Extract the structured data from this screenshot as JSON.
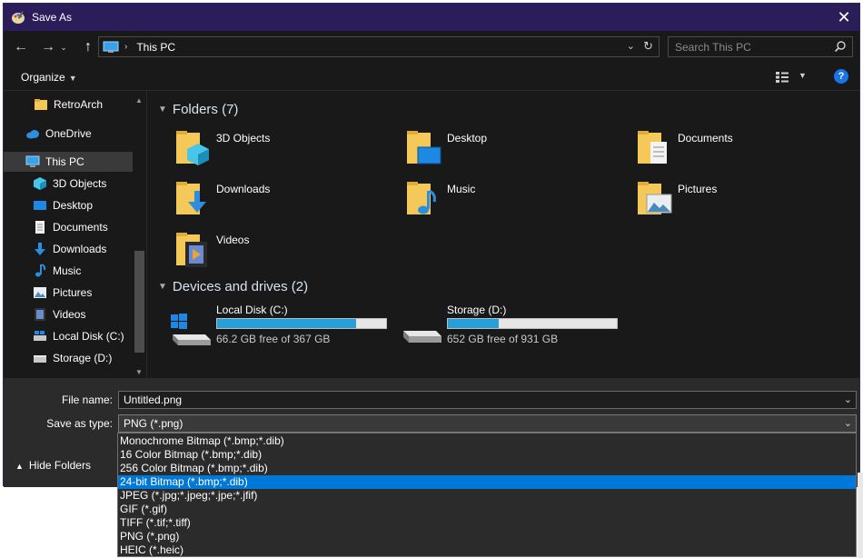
{
  "window": {
    "title": "Save As",
    "close_label": "✕",
    "app_icon": "paint-palette-icon"
  },
  "nav": {
    "back": "←",
    "forward": "→",
    "recent": "⌄",
    "up": "↑",
    "address_path": "This PC",
    "address_sep": "›",
    "search_placeholder": "Search This PC"
  },
  "toolbar": {
    "organize_label": "Organize",
    "help_label": "?"
  },
  "sidebar": {
    "items": [
      {
        "label": "RetroArch",
        "icon": "folder-icon"
      },
      {
        "label": "OneDrive",
        "icon": "cloud-icon"
      },
      {
        "label": "This PC",
        "icon": "computer-icon",
        "selected": true
      },
      {
        "label": "3D Objects",
        "icon": "cube-icon"
      },
      {
        "label": "Desktop",
        "icon": "desktop-icon"
      },
      {
        "label": "Documents",
        "icon": "document-icon"
      },
      {
        "label": "Downloads",
        "icon": "download-icon"
      },
      {
        "label": "Music",
        "icon": "music-icon"
      },
      {
        "label": "Pictures",
        "icon": "picture-icon"
      },
      {
        "label": "Videos",
        "icon": "video-icon"
      },
      {
        "label": "Local Disk (C:)",
        "icon": "drive-icon"
      },
      {
        "label": "Storage (D:)",
        "icon": "drive-icon"
      }
    ]
  },
  "content": {
    "folders_header": "Folders (7)",
    "folders": [
      {
        "label": "3D Objects",
        "icon": "cube-folder-icon"
      },
      {
        "label": "Desktop",
        "icon": "desktop-folder-icon"
      },
      {
        "label": "Documents",
        "icon": "documents-folder-icon"
      },
      {
        "label": "Downloads",
        "icon": "downloads-folder-icon"
      },
      {
        "label": "Music",
        "icon": "music-folder-icon"
      },
      {
        "label": "Pictures",
        "icon": "pictures-folder-icon"
      },
      {
        "label": "Videos",
        "icon": "videos-folder-icon"
      }
    ],
    "drives_header": "Devices and drives (2)",
    "drives": [
      {
        "label": "Local Disk (C:)",
        "free": "66.2 GB free of 367 GB",
        "used_fraction": 0.82
      },
      {
        "label": "Storage (D:)",
        "free": "652 GB free of 931 GB",
        "used_fraction": 0.3
      }
    ]
  },
  "bottom": {
    "filename_label": "File name:",
    "filename_value": "Untitled.png",
    "type_label": "Save as type:",
    "type_value": "PNG (*.png)",
    "hide_folders": "Hide Folders"
  },
  "type_options": [
    "Monochrome Bitmap (*.bmp;*.dib)",
    "16 Color Bitmap (*.bmp;*.dib)",
    "256 Color Bitmap (*.bmp;*.dib)",
    "24-bit Bitmap (*.bmp;*.dib)",
    "JPEG (*.jpg;*.jpeg;*.jpe;*.jfif)",
    "GIF (*.gif)",
    "TIFF (*.tif;*.tiff)",
    "PNG (*.png)",
    "HEIC (*.heic)"
  ],
  "type_selected_index": 3,
  "colors": {
    "titlebar": "#2b1d5a",
    "accent": "#0078d7",
    "drive_bar": "#26a0da",
    "folder": "#f5c85a"
  }
}
